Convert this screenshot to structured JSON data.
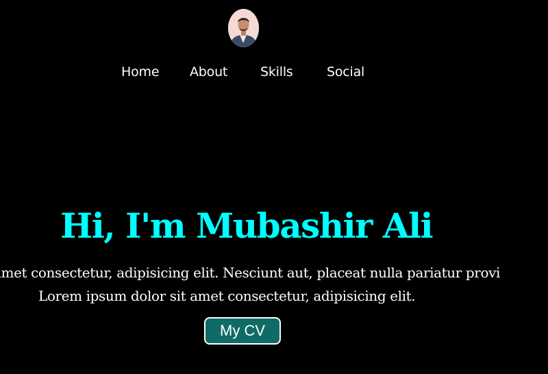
{
  "header": {
    "avatar_icon": "profile-photo"
  },
  "nav": {
    "items": [
      {
        "label": "Home"
      },
      {
        "label": "About"
      },
      {
        "label": "Skills"
      },
      {
        "label": "Social"
      }
    ]
  },
  "hero": {
    "title": "Hi, I'm Mubashir Ali",
    "line1": "amet consectetur, adipisicing elit. Nesciunt aut, placeat nulla pariatur provi",
    "line2": "Lorem ipsum dolor sit amet consectetur, adipisicing elit.",
    "cta_label": "My CV"
  },
  "colors": {
    "background": "#000000",
    "title": "#00ffff",
    "text": "#ffffff",
    "button": "#0f6b66"
  }
}
